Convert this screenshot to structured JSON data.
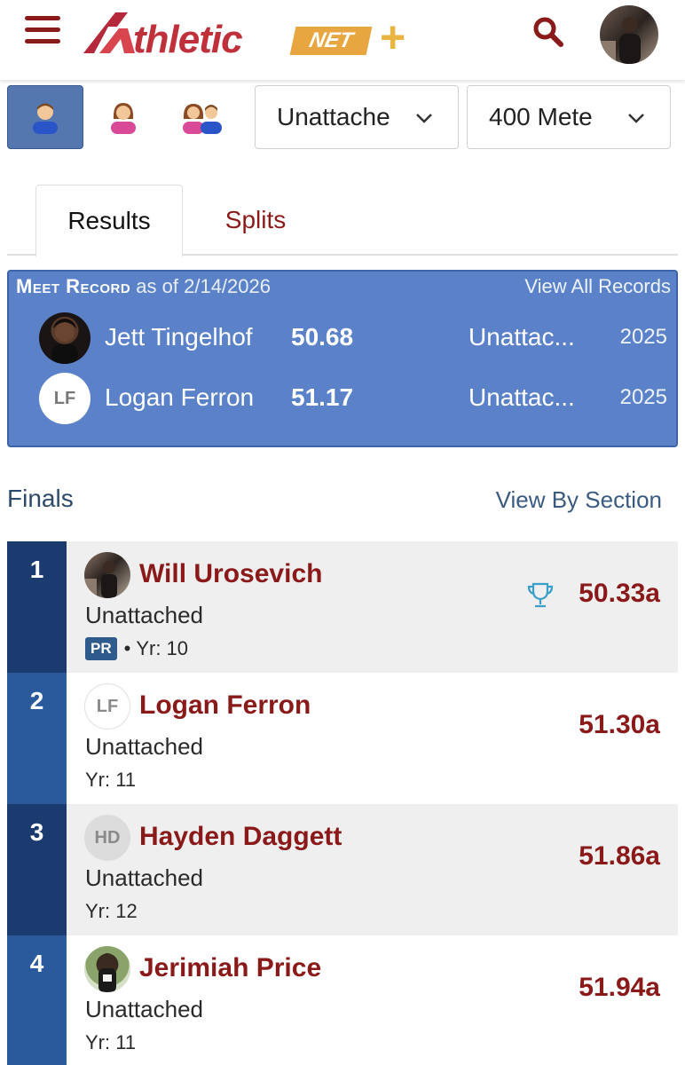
{
  "header": {
    "logo_text": "thletic",
    "logo_net": "NET",
    "logo_plus": "+"
  },
  "filters": {
    "team_select": "Unattache",
    "event_select": "400 Mete"
  },
  "tabs": {
    "results": "Results",
    "splits": "Splits"
  },
  "meet_record": {
    "title": "Meet Record",
    "as_of": "as of 2/14/2026",
    "view_all": "View All Records",
    "entries": [
      {
        "initials": "",
        "name": "Jett Tingelhof",
        "time": "50.68",
        "team": "Unattac...",
        "year": "2025"
      },
      {
        "initials": "LF",
        "name": "Logan Ferron",
        "time": "51.17",
        "team": "Unattac...",
        "year": "2025"
      }
    ]
  },
  "finals": {
    "title": "Finals",
    "view_by_section": "View By Section",
    "results": [
      {
        "place": "1",
        "initials": "",
        "name": "Will Urosevich",
        "team": "Unattached",
        "badge": "PR",
        "sep": "•",
        "year": "Yr: 10",
        "mark": "50.33a"
      },
      {
        "place": "2",
        "initials": "LF",
        "name": "Logan Ferron",
        "team": "Unattached",
        "badge": "",
        "sep": "",
        "year": "Yr: 11",
        "mark": "51.30a"
      },
      {
        "place": "3",
        "initials": "HD",
        "name": "Hayden Daggett",
        "team": "Unattached",
        "badge": "",
        "sep": "",
        "year": "Yr: 12",
        "mark": "51.86a"
      },
      {
        "place": "4",
        "initials": "",
        "name": "Jerimiah Price",
        "team": "Unattached",
        "badge": "",
        "sep": "",
        "year": "Yr: 11",
        "mark": "51.94a"
      }
    ]
  },
  "colors": {
    "brand_maroon": "#8a1a1a",
    "record_blue": "#5b82c8",
    "place_dark": "#1a3a70",
    "place_mid": "#2b5a9c",
    "logo_gold": "#e8a640"
  },
  "icons": {
    "menu": "hamburger-icon",
    "search": "search-icon",
    "male": "male-athlete-icon",
    "female": "female-athlete-icon",
    "both": "both-genders-icon",
    "dropdown": "chevron-down-icon",
    "trophy": "trophy-icon"
  }
}
